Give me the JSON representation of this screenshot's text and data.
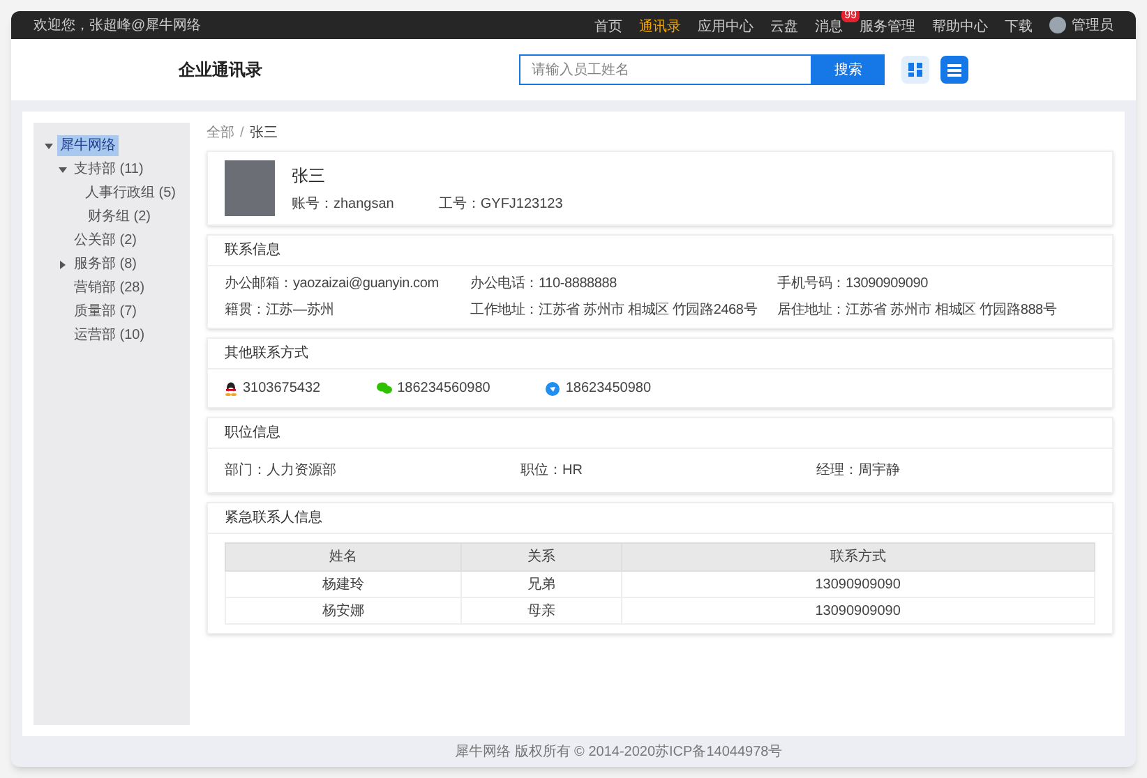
{
  "top_bar": {
    "welcome": "欢迎您，张超峰@犀牛网络",
    "nav": [
      {
        "label": "首页",
        "selected": false
      },
      {
        "label": "通讯录",
        "selected": true
      },
      {
        "label": "应用中心",
        "selected": false
      },
      {
        "label": "云盘",
        "selected": false
      },
      {
        "label": "消息",
        "selected": false,
        "badge": "99"
      },
      {
        "label": "服务管理",
        "selected": false
      },
      {
        "label": "帮助中心",
        "selected": false
      },
      {
        "label": "下载",
        "selected": false
      }
    ],
    "user": "管理员"
  },
  "header": {
    "title": "企业通讯录",
    "search": {
      "placeholder": "请输入员工姓名",
      "button": "搜索"
    },
    "views": [
      {
        "kind": "grid",
        "selected": false
      },
      {
        "kind": "list",
        "selected": true
      }
    ]
  },
  "sidebar": {
    "tree": [
      {
        "label": "犀牛网络",
        "selected": true,
        "expanded": true,
        "children": [
          {
            "label": "支持部 (11)",
            "selected": false,
            "expanded": true,
            "children": [
              {
                "label": "人事行政组 (5)",
                "selected": false
              },
              {
                "label": "财务组 (2)",
                "selected": false
              }
            ]
          },
          {
            "label": "公关部 (2)",
            "selected": false
          },
          {
            "label": "服务部 (8)",
            "selected": false,
            "expanded": false
          },
          {
            "label": "营销部 (28)",
            "selected": false
          },
          {
            "label": "质量部 (7)",
            "selected": false
          },
          {
            "label": "运营部 (10)",
            "selected": false
          }
        ]
      }
    ]
  },
  "breadcrumb": {
    "items": [
      "全部",
      "张三"
    ],
    "separator": "/"
  },
  "profile": {
    "name": "张三",
    "fields": [
      {
        "label": "账号：",
        "value": "zhangsan"
      },
      {
        "label": "工号：",
        "value": "GYFJ123123"
      }
    ]
  },
  "contact_info": {
    "title": "联系信息",
    "fields": [
      {
        "label": "办公邮箱：",
        "value": "yaozaizai@guanyin.com"
      },
      {
        "label": "办公电话：",
        "value": "110-8888888"
      },
      {
        "label": "手机号码：",
        "value": "13090909090"
      },
      {
        "label": "籍贯：",
        "value": "江苏—苏州"
      },
      {
        "label": "工作地址：",
        "value": "江苏省 苏州市 相城区 竹园路2468号"
      },
      {
        "label": "居住地址：",
        "value": "江苏省 苏州市 相城区 竹园路888号"
      }
    ]
  },
  "other_contacts": {
    "title": "其他联系方式",
    "items": [
      {
        "kind": "qq",
        "value": "3103675432"
      },
      {
        "kind": "wechat",
        "value": "186234560980"
      },
      {
        "kind": "other",
        "value": "18623450980"
      }
    ]
  },
  "job_info": {
    "title": "职位信息",
    "fields": [
      {
        "label": "部门：",
        "value": "人力资源部"
      },
      {
        "label": "职位：",
        "value": "HR"
      },
      {
        "label": "经理：",
        "value": "周宇静"
      }
    ]
  },
  "emergency_contacts": {
    "title": "紧急联系人信息",
    "columns": [
      "姓名",
      "关系",
      "联系方式"
    ],
    "rows": [
      [
        "杨建玲",
        "兄弟",
        "13090909090"
      ],
      [
        "杨安娜",
        "母亲",
        "13090909090"
      ]
    ]
  },
  "footer": "犀牛网络 版权所有 © 2014-2020苏ICP备14044978号"
}
